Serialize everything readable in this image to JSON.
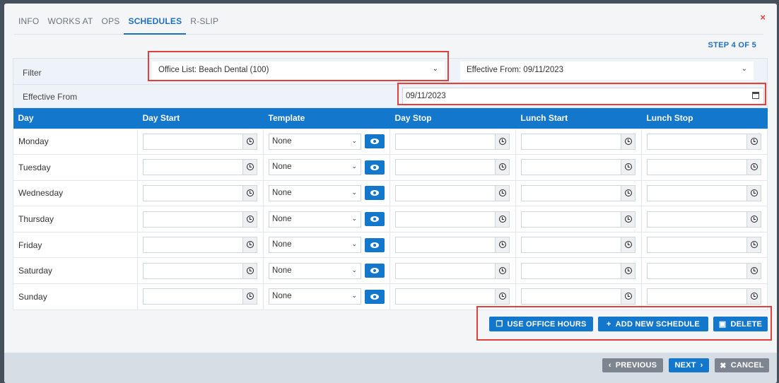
{
  "tabs": [
    "INFO",
    "WORKS AT",
    "OPS",
    "SCHEDULES",
    "R-SLIP"
  ],
  "active_tab": "SCHEDULES",
  "close_glyph": "×",
  "step_text": "STEP 4 OF 5",
  "filter": {
    "label": "Filter",
    "office_select": "Office List: Beach Dental (100)",
    "effective_select": "Effective From: 09/11/2023"
  },
  "effective_from": {
    "label": "Effective From",
    "value": "09/11/2023"
  },
  "table": {
    "headers": [
      "Day",
      "Day Start",
      "Template",
      "Day Stop",
      "Lunch Start",
      "Lunch Stop"
    ],
    "rows": [
      {
        "day": "Monday",
        "template": "None"
      },
      {
        "day": "Tuesday",
        "template": "None"
      },
      {
        "day": "Wednesday",
        "template": "None"
      },
      {
        "day": "Thursday",
        "template": "None"
      },
      {
        "day": "Friday",
        "template": "None"
      },
      {
        "day": "Saturday",
        "template": "None"
      },
      {
        "day": "Sunday",
        "template": "None"
      }
    ]
  },
  "actions": {
    "use_office_hours": "USE OFFICE HOURS",
    "add_new_schedule": "ADD NEW SCHEDULE",
    "delete": "DELETE"
  },
  "footer": {
    "previous": "PREVIOUS",
    "next": "NEXT",
    "cancel": "CANCEL"
  },
  "colors": {
    "accent": "#1377cc",
    "highlight": "#e2403a",
    "secondary_button": "#7d8590"
  },
  "icons": [
    "clock-icon",
    "eye-icon",
    "calendar-icon",
    "copy-icon",
    "plus-icon",
    "trash-icon",
    "chevron-left-icon",
    "chevron-right-icon",
    "close-icon",
    "chevron-down-icon"
  ]
}
